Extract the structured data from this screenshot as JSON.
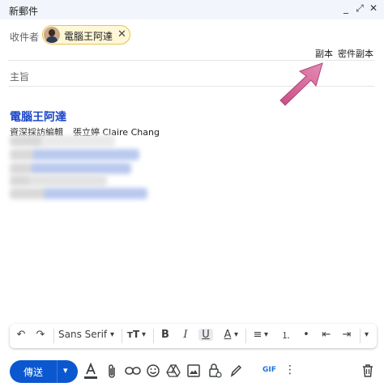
{
  "window": {
    "title": "新郵件",
    "controls": [
      "_",
      "⤢",
      "✕"
    ]
  },
  "to": {
    "label": "收件者",
    "chip_name": "電腦王阿達",
    "chip_remove": "✕"
  },
  "cc": {
    "cc_label": "副本",
    "bcc_label": "密件副本"
  },
  "subject": {
    "placeholder": "主旨"
  },
  "signature": {
    "name": "電腦王阿達",
    "role": "資深採訪編輯",
    "person": "張立婷 Claire Chang"
  },
  "format_bar": {
    "undo": "↶",
    "redo": "↷",
    "font": "Sans Serif",
    "font_caret": "▾",
    "size": "тT",
    "size_caret": "▾",
    "bold": "B",
    "italic": "I",
    "underline": "U",
    "text_color": "A",
    "text_color_caret": "▾",
    "align": "≡",
    "align_caret": "▾",
    "numbered_list": "⒈",
    "bulleted_list": "•",
    "indent_less": "⇤",
    "indent_more": "⇥",
    "more_caret": "▾"
  },
  "bottom_bar": {
    "send_label": "傳送",
    "send_caret": "▾",
    "gif_label": "GIF",
    "more": "⋮",
    "icons": [
      "formatting-icon",
      "attach-icon",
      "link-icon",
      "emoji-icon",
      "drive-icon",
      "photo-icon",
      "confidential-icon",
      "signature-icon",
      "more-options-icon",
      "trash-icon"
    ]
  },
  "colors": {
    "accent": "#0b57d0",
    "signature_name": "#1a45c8",
    "chip_bg": "#fff8d6",
    "chip_border": "#e8c34a",
    "arrow": "#d8649a",
    "titlebar": "#f2f6fc"
  }
}
